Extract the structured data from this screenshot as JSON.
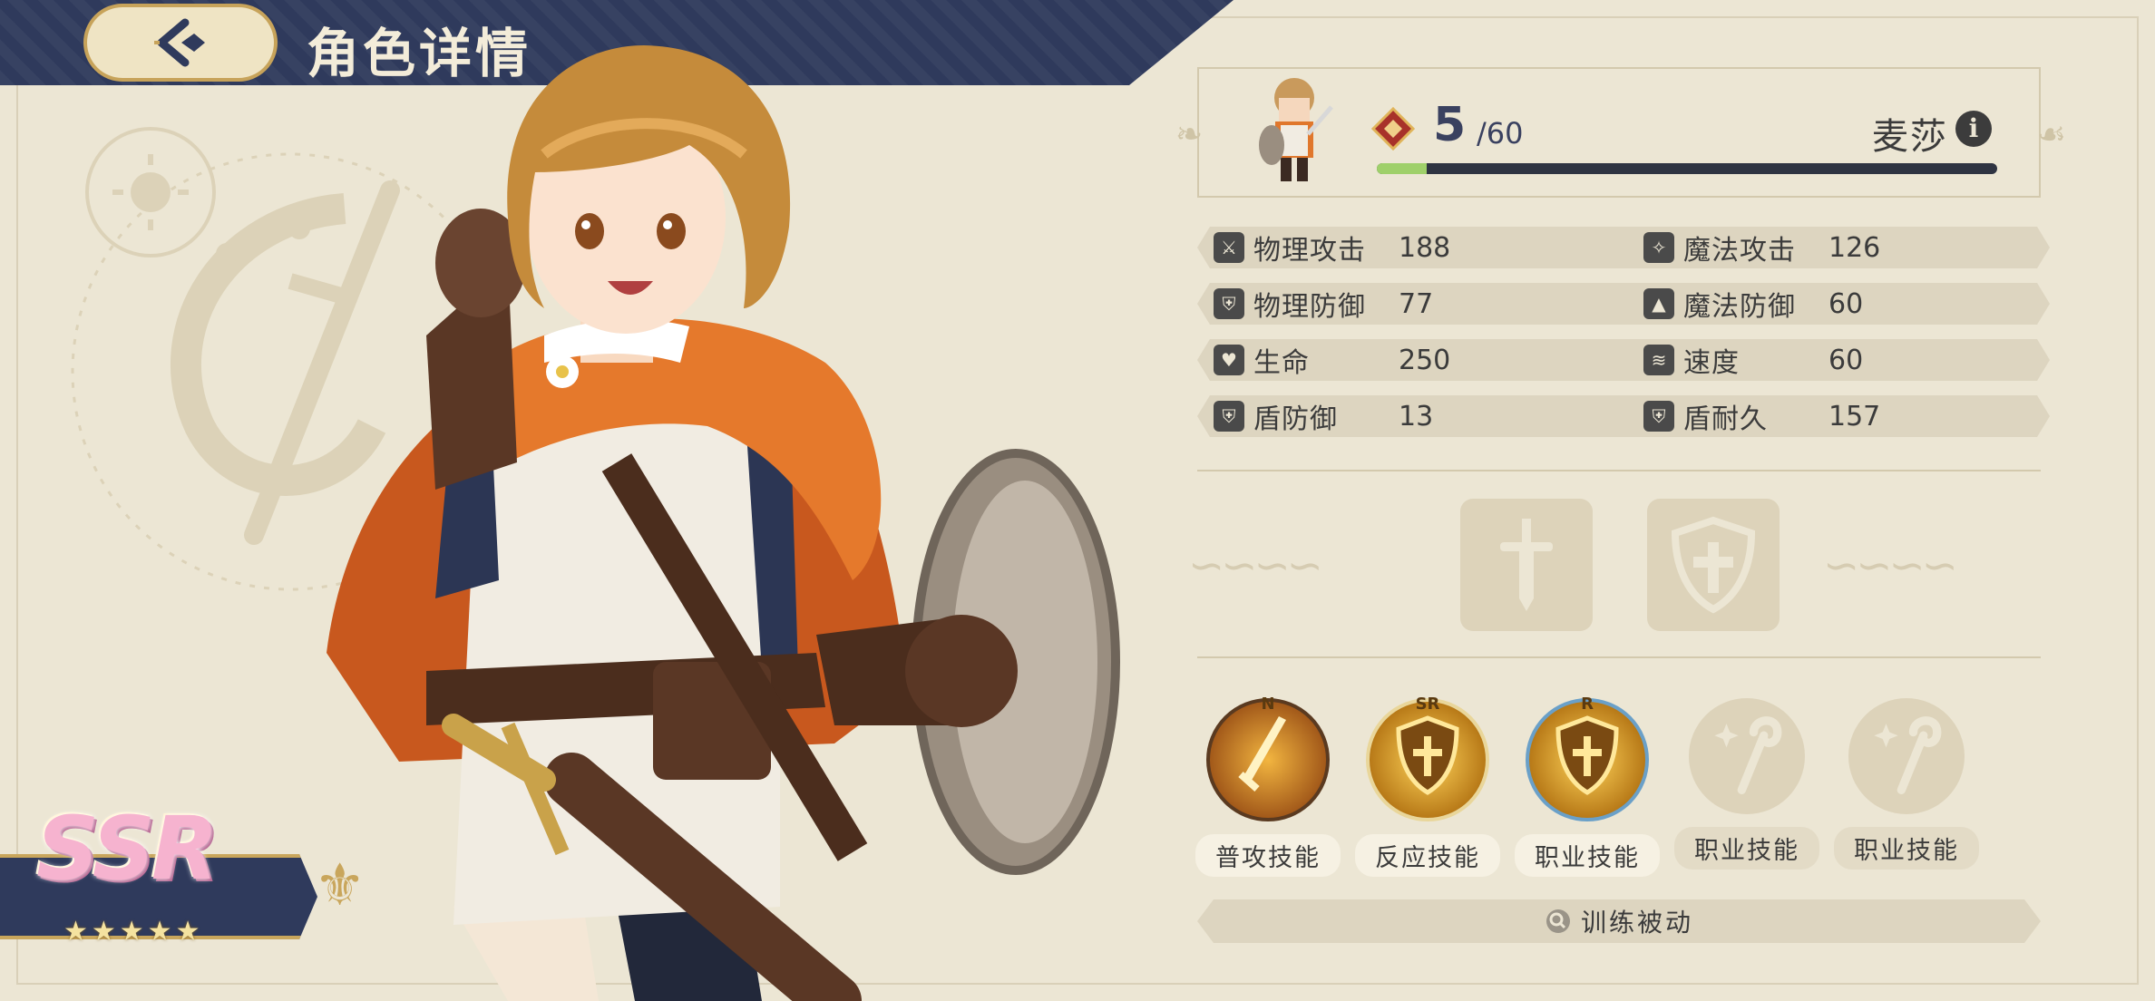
{
  "header": {
    "title": "角色详情",
    "back_icon": "back-arrow-icon"
  },
  "rarity": {
    "text": "SSR",
    "stars": "★★★★★",
    "star_count": 5
  },
  "character": {
    "name": "麦莎",
    "level": "5",
    "level_max": "/60",
    "exp_fraction": 0.08
  },
  "stats": [
    {
      "label": "物理攻击",
      "value": "188",
      "icon": "sword-icon"
    },
    {
      "label": "魔法攻击",
      "value": "126",
      "icon": "staff-icon"
    },
    {
      "label": "物理防御",
      "value": "77",
      "icon": "shield-icon"
    },
    {
      "label": "魔法防御",
      "value": "60",
      "icon": "wizard-hat-icon"
    },
    {
      "label": "生命",
      "value": "250",
      "icon": "heart-icon"
    },
    {
      "label": "速度",
      "value": "60",
      "icon": "wing-icon"
    },
    {
      "label": "盾防御",
      "value": "13",
      "icon": "shield-icon"
    },
    {
      "label": "盾耐久",
      "value": "157",
      "icon": "shield-icon"
    }
  ],
  "equipment": [
    {
      "slot": "weapon",
      "icon": "sword-icon"
    },
    {
      "slot": "shield",
      "icon": "cross-shield-icon"
    }
  ],
  "skills": [
    {
      "label": "普攻技能",
      "tag": "N",
      "locked": false
    },
    {
      "label": "反应技能",
      "tag": "SR",
      "locked": false
    },
    {
      "label": "职业技能",
      "tag": "R",
      "locked": false
    },
    {
      "label": "职业技能",
      "tag": "",
      "locked": true
    },
    {
      "label": "职业技能",
      "tag": "",
      "locked": true
    }
  ],
  "train_button": {
    "label": "训练被动",
    "icon": "search-icon"
  },
  "colors": {
    "background": "#ece6d4",
    "header": "#2f3a5c",
    "gold": "#c9a65c",
    "exp": "#9fd06a"
  }
}
